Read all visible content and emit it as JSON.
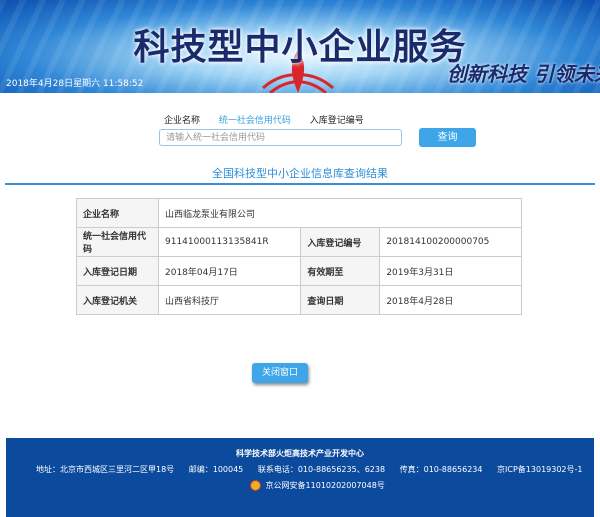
{
  "banner": {
    "title": "科技型中小企业服务",
    "slogan": "创新科技 引领未来",
    "datetime": "2018年4月28日星期六 11:58:52"
  },
  "search": {
    "tabs": [
      "企业名称",
      "统一社会信用代码",
      "入库登记编号"
    ],
    "active_tab": "统一社会信用代码",
    "placeholder": "请输入统一社会信用代码",
    "button_label": "查询"
  },
  "result": {
    "title": "全国科技型中小企业信息库查询结果",
    "company_name_label": "企业名称",
    "company_name": "山西临龙泵业有限公司",
    "credit_code_label": "统一社会信用代码",
    "credit_code": "91141000113135841R",
    "reg_no_label": "入库登记编号",
    "reg_no": "201814100200000705",
    "reg_date_label": "入库登记日期",
    "reg_date": "2018年04月17日",
    "valid_until_label": "有效期至",
    "valid_until": "2019年3月31日",
    "reg_authority_label": "入库登记机关",
    "reg_authority": "山西省科技厅",
    "query_date_label": "查询日期",
    "query_date": "2018年4月28日"
  },
  "close_button_label": "关闭窗口",
  "footer": {
    "org": "科学技术部火炬高技术产业开发中心",
    "address": "地址：北京市西城区三里河二区甲18号",
    "postcode": "邮编：100045",
    "phone": "联系电话：010-88656235、6238",
    "fax": "传真：010-88656234",
    "icp": "京ICP备13019302号-1",
    "police": "京公网安备11010202007048号"
  },
  "colors": {
    "accent": "#3ea6e8",
    "footer_bg": "#0c4a9e",
    "title_blue": "#2d8ed6"
  }
}
